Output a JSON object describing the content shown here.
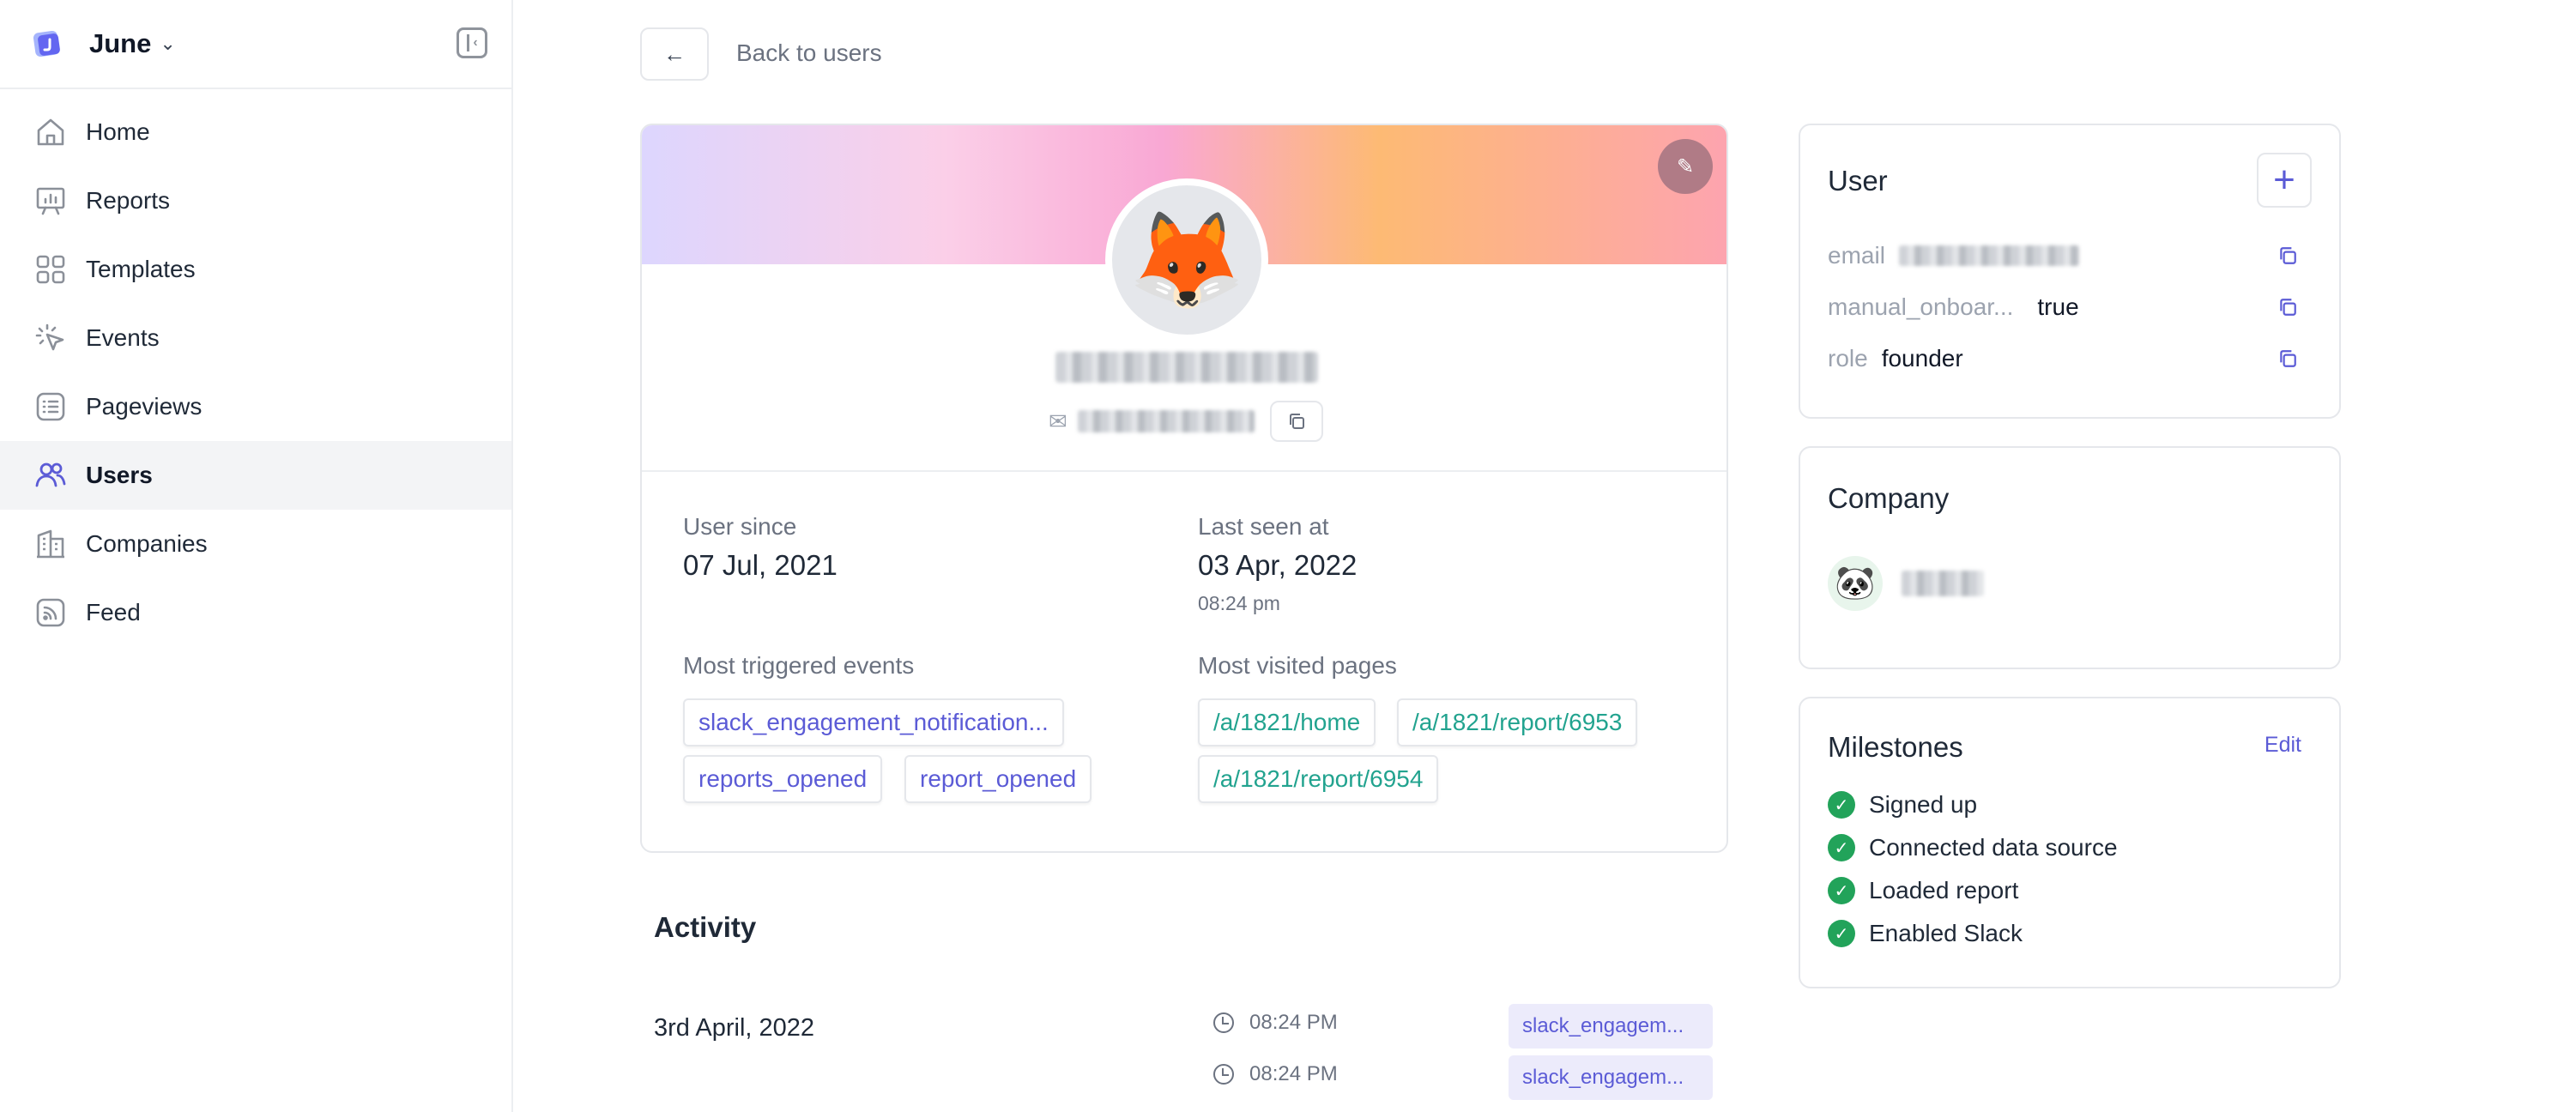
{
  "workspace": {
    "name": "June",
    "chevron": "⌄"
  },
  "sidebar": {
    "items": [
      {
        "label": "Home",
        "icon": "home-icon"
      },
      {
        "label": "Reports",
        "icon": "presentation-chart-icon"
      },
      {
        "label": "Templates",
        "icon": "grid-icon"
      },
      {
        "label": "Events",
        "icon": "cursor-click-icon"
      },
      {
        "label": "Pageviews",
        "icon": "list-icon"
      },
      {
        "label": "Users",
        "icon": "users-icon",
        "active": true
      },
      {
        "label": "Companies",
        "icon": "office-building-icon"
      },
      {
        "label": "Feed",
        "icon": "rss-icon"
      }
    ]
  },
  "header": {
    "back_arrow": "←",
    "back_label": "Back to users"
  },
  "profile": {
    "avatar_emoji": "🦊",
    "edit_icon": "✎",
    "user_since_label": "User since",
    "user_since": "07 Jul, 2021",
    "last_seen_label": "Last seen at",
    "last_seen_date": "03 Apr, 2022",
    "last_seen_time": "08:24 pm",
    "events_label": "Most triggered events",
    "events": [
      "slack_engagement_notification...",
      "reports_opened",
      "report_opened"
    ],
    "pages_label": "Most visited pages",
    "pages": [
      "/a/1821/home",
      "/a/1821/report/6953",
      "/a/1821/report/6954"
    ]
  },
  "activity": {
    "title": "Activity",
    "date": "3rd April, 2022",
    "rows": [
      {
        "time": "08:24 PM",
        "event": "slack_engagem..."
      },
      {
        "time": "08:24 PM",
        "event": "slack_engagem..."
      }
    ]
  },
  "user_card": {
    "title": "User",
    "add_label": "+",
    "props": [
      {
        "key": "email",
        "value": ""
      },
      {
        "key": "manual_onboar...",
        "value": "true"
      },
      {
        "key": "role",
        "value": "founder"
      }
    ]
  },
  "company_card": {
    "title": "Company",
    "logo_emoji": "🐼"
  },
  "milestones_card": {
    "title": "Milestones",
    "edit_label": "Edit",
    "check": "✓",
    "items": [
      "Signed up",
      "Connected data source",
      "Loaded report",
      "Enabled Slack"
    ]
  },
  "colors": {
    "accent": "#5b5bd6",
    "page_link": "#22a38f",
    "milestone_check": "#22a35a",
    "active_nav_bg": "#f3f4f6"
  }
}
